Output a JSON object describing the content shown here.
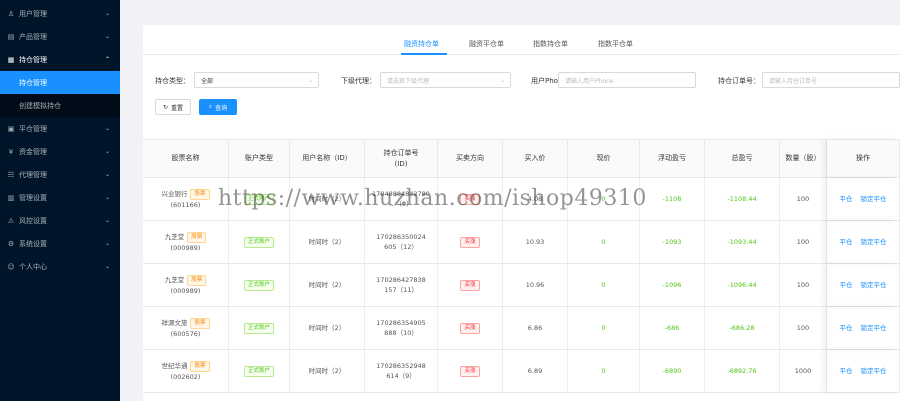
{
  "sidebar": {
    "items": [
      {
        "label": "用户管理",
        "icon": "user-icon"
      },
      {
        "label": "产品管理",
        "icon": "product-icon"
      },
      {
        "label": "持仓管理",
        "icon": "position-icon",
        "open": true,
        "children": [
          {
            "label": "持仓管理",
            "active": true
          },
          {
            "label": "创建模拟持仓"
          }
        ]
      },
      {
        "label": "平仓管理",
        "icon": "close-position-icon"
      },
      {
        "label": "资金管理",
        "icon": "money-icon"
      },
      {
        "label": "代理管理",
        "icon": "agent-icon"
      },
      {
        "label": "管理设置",
        "icon": "admin-icon"
      },
      {
        "label": "风控设置",
        "icon": "risk-icon"
      },
      {
        "label": "系统设置",
        "icon": "setting-icon"
      },
      {
        "label": "个人中心",
        "icon": "person-icon"
      }
    ]
  },
  "tabs": [
    "融资持仓单",
    "融资平仓单",
    "指数持仓单",
    "指数平仓单"
  ],
  "filters": {
    "type_label": "持仓类型：",
    "type_value": "全部",
    "agent_label": "下级代理：",
    "agent_placeholder": "请选择下级代理",
    "phone_label": "用户Phone:",
    "phone_placeholder": "请输入用户Phone",
    "order_label": "持仓订单号：",
    "order_placeholder": "请输入持仓订单号",
    "reset_label": "重置",
    "query_label": "查询"
  },
  "table": {
    "headers": [
      "股票名称",
      "账户类型",
      "用户名称（ID）",
      "持仓订单号\n(ID)",
      "买卖方向",
      "买入价",
      "现价",
      "浮动盈亏",
      "总盈亏",
      "数量（股）",
      "操作"
    ],
    "rows": [
      {
        "name": "兴业银行",
        "tag": "股票",
        "code": "(601166)",
        "account": "正式账户",
        "user": "时间时（2）",
        "order1": "17048884842780",
        "order2": "...（9）",
        "dir": "买涨",
        "buy": "4.08",
        "now": "0",
        "float": "-1108",
        "total": "-1108.44",
        "qty": "100"
      },
      {
        "name": "九芝堂",
        "tag": "股票",
        "code": "(000989)",
        "account": "正式账户",
        "user": "时间时（2）",
        "order1": "170286350024",
        "order2": "605（12）",
        "dir": "买涨",
        "buy": "10.93",
        "now": "0",
        "float": "-1093",
        "total": "-1093.44",
        "qty": "100"
      },
      {
        "name": "九芝堂",
        "tag": "股票",
        "code": "(000989)",
        "account": "正式账户",
        "user": "时间时（2）",
        "order1": "170286427838",
        "order2": "157（11）",
        "dir": "买涨",
        "buy": "10.96",
        "now": "0",
        "float": "-1096",
        "total": "-1096.44",
        "qty": "100"
      },
      {
        "name": "祥源文旅",
        "tag": "股票",
        "code": "(600576)",
        "account": "正式账户",
        "user": "时间时（2）",
        "order1": "170286354905",
        "order2": "888（10）",
        "dir": "买涨",
        "buy": "6.86",
        "now": "0",
        "float": "-686",
        "total": "-686.28",
        "qty": "100"
      },
      {
        "name": "世纪华通",
        "tag": "股票",
        "code": "(002602)",
        "account": "正式账户",
        "user": "时间时（2）",
        "order1": "170286352948",
        "order2": "614（9）",
        "dir": "买涨",
        "buy": "6.89",
        "now": "0",
        "float": "-6890",
        "total": "-6892.76",
        "qty": "1000"
      }
    ],
    "op_sell": "平仓",
    "op_lock": "锁定平仓"
  },
  "watermark": "https://www.huzhan.com/ishop49310"
}
